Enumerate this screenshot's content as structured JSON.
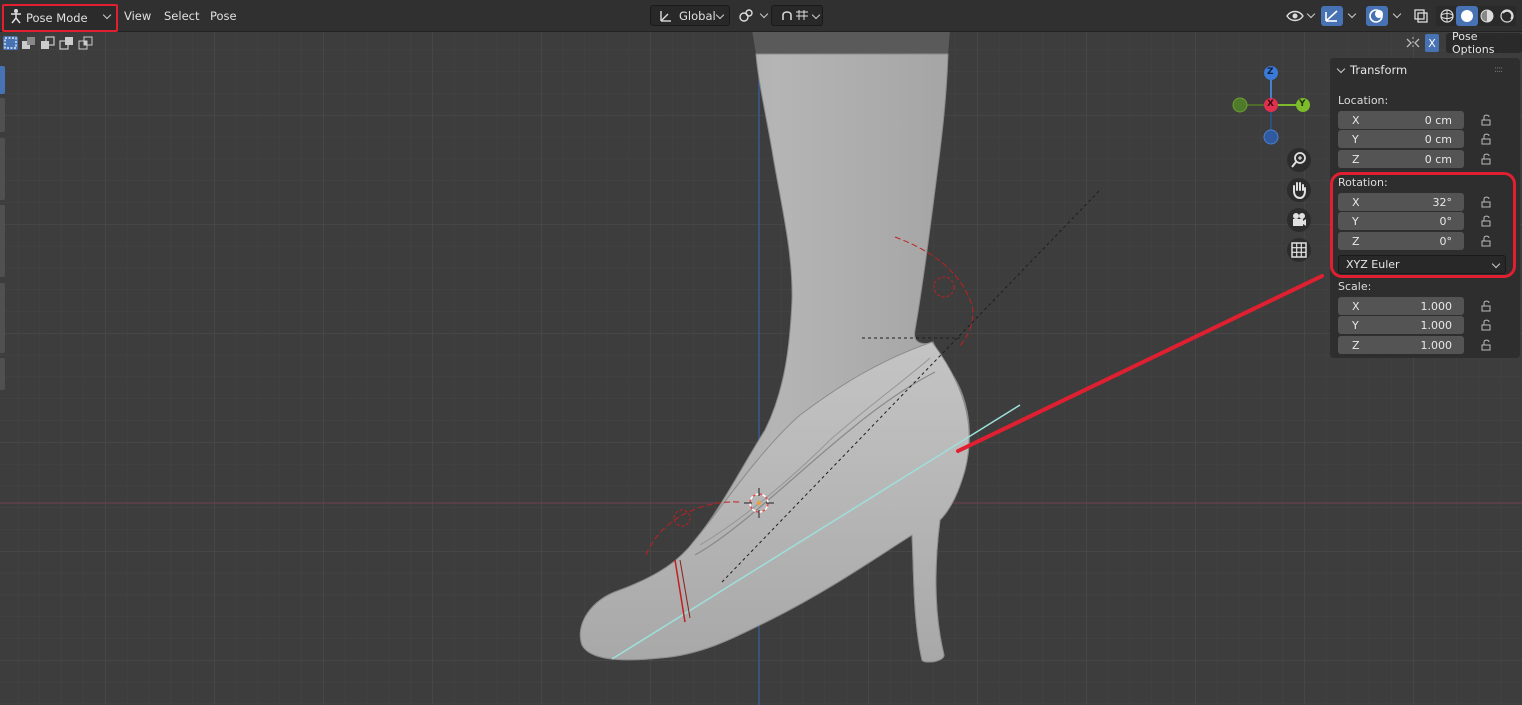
{
  "header": {
    "mode": "Pose Mode",
    "menus": [
      "View",
      "Select",
      "Pose"
    ],
    "orientation": "Global"
  },
  "toolbar": {
    "pose_options": "Pose Options",
    "x_toggle": "X"
  },
  "gizmo": {
    "x": "X",
    "y": "Y",
    "z": "Z"
  },
  "transform_panel": {
    "title": "Transform",
    "location": {
      "label": "Location:",
      "fields": [
        {
          "axis": "X",
          "value": "0 cm"
        },
        {
          "axis": "Y",
          "value": "0 cm"
        },
        {
          "axis": "Z",
          "value": "0 cm"
        }
      ]
    },
    "rotation": {
      "label": "Rotation:",
      "fields": [
        {
          "axis": "X",
          "value": "32°"
        },
        {
          "axis": "Y",
          "value": "0°"
        },
        {
          "axis": "Z",
          "value": "0°"
        }
      ],
      "mode": "XYZ Euler"
    },
    "scale": {
      "label": "Scale:",
      "fields": [
        {
          "axis": "X",
          "value": "1.000"
        },
        {
          "axis": "Y",
          "value": "1.000"
        },
        {
          "axis": "Z",
          "value": "1.000"
        }
      ]
    }
  },
  "colors": {
    "highlight": "#e02030",
    "viewport_bg": "#3d3d3d",
    "mesh": "#b8b8b8",
    "active_blue": "#4772b3"
  },
  "icons": [
    "pose-mode-icon",
    "transform-orientation-icon",
    "pivot-icon",
    "snap-icon",
    "zoom-icon",
    "hand-pan-icon",
    "camera-icon",
    "grid-icon",
    "visibility-icon",
    "gizmo-icon",
    "overlay-icon",
    "xray-icon",
    "shading-wireframe-icon",
    "shading-solid-icon",
    "shading-material-icon",
    "shading-rendered-icon",
    "lock-icon"
  ]
}
